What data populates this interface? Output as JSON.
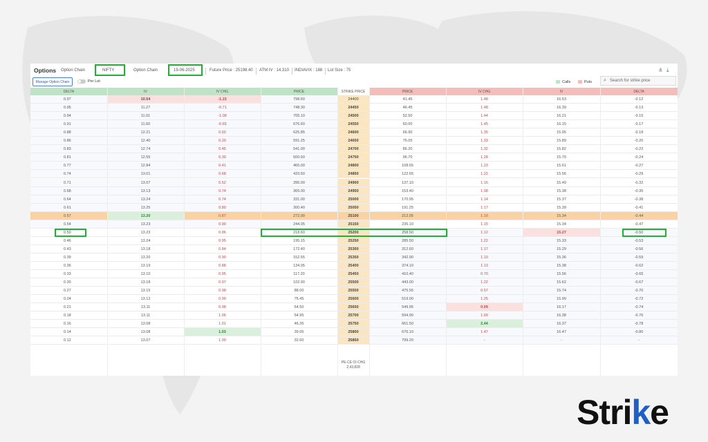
{
  "header": {
    "title": "Options",
    "tab_option_chain": "Option Chain",
    "symbol": "NIFTY",
    "tab_option_chain_2": "Option Chain",
    "expiry": "19-06-2025",
    "future_price": "Future Price : 25198.40",
    "atm_iv": "ATM IV : 14.310",
    "india_vix": "INDIAVIX : 188",
    "lot_size": "Lot Size : 75"
  },
  "toolbar": {
    "manage_label": "Manage Option Chain",
    "per_lot_label": "Per Lot",
    "legend_calls": "Calls",
    "legend_puts": "Puts",
    "search_placeholder": "Search for strike price"
  },
  "columns": {
    "call": [
      "DELTA",
      "IV",
      "IV CHG",
      "PRICE"
    ],
    "strike": "STRIKE PRICE",
    "put": [
      "PRICE",
      "IV CHG",
      "IV",
      "DELTA"
    ]
  },
  "rows": [
    {
      "strike": "24400",
      "c_delta": "0.97",
      "c_iv": "10.54",
      "c_ivchg": "-1.15",
      "c_price": "798.60",
      "p_price": "41.45",
      "p_ivchg": "1.48",
      "p_iv": "16.53",
      "p_delta": "-0.12"
    },
    {
      "strike": "24450",
      "c_delta": "0.95",
      "c_iv": "11.27",
      "c_ivchg": "-0.71",
      "c_price": "748.30",
      "p_price": "46.45",
      "p_ivchg": "1.48",
      "p_iv": "16.39",
      "p_delta": "-0.13"
    },
    {
      "strike": "24500",
      "c_delta": "0.94",
      "c_iv": "11.01",
      "c_ivchg": "-1.08",
      "c_price": "705.10",
      "p_price": "52.50",
      "p_ivchg": "1.44",
      "p_iv": "16.21",
      "p_delta": "-0.15"
    },
    {
      "strike": "24550",
      "c_delta": "0.91",
      "c_iv": "11.60",
      "c_ivchg": "-0.65",
      "c_price": "676.60",
      "p_price": "60.00",
      "p_ivchg": "1.45",
      "p_iv": "16.15",
      "p_delta": "-0.17"
    },
    {
      "strike": "24600",
      "c_delta": "0.88",
      "c_iv": "12.21",
      "c_ivchg": "0.02",
      "c_price": "625.85",
      "p_price": "66.90",
      "p_ivchg": "1.35",
      "p_iv": "15.95",
      "p_delta": "-0.18"
    },
    {
      "strike": "24650",
      "c_delta": "0.86",
      "c_iv": "12.40",
      "c_ivchg": "0.20",
      "c_price": "591.25",
      "p_price": "76.05",
      "p_ivchg": "1.33",
      "p_iv": "15.89",
      "p_delta": "-0.20"
    },
    {
      "strike": "24700",
      "c_delta": "0.83",
      "c_iv": "12.74",
      "c_ivchg": "0.45",
      "c_price": "541.00",
      "p_price": "86.20",
      "p_ivchg": "1.32",
      "p_iv": "15.82",
      "p_delta": "-0.22"
    },
    {
      "strike": "24750",
      "c_delta": "0.81",
      "c_iv": "12.55",
      "c_ivchg": "0.30",
      "c_price": "500.60",
      "p_price": "96.70",
      "p_ivchg": "1.28",
      "p_iv": "15.70",
      "p_delta": "-0.24"
    },
    {
      "strike": "24800",
      "c_delta": "0.77",
      "c_iv": "12.84",
      "c_ivchg": "0.41",
      "c_price": "465.00",
      "p_price": "108.65",
      "p_ivchg": "1.23",
      "p_iv": "15.61",
      "p_delta": "-0.27"
    },
    {
      "strike": "24850",
      "c_delta": "0.74",
      "c_iv": "13.01",
      "c_ivchg": "0.68",
      "c_price": "433.50",
      "p_price": "122.65",
      "p_ivchg": "1.22",
      "p_iv": "15.56",
      "p_delta": "-0.29"
    },
    {
      "strike": "24900",
      "c_delta": "0.71",
      "c_iv": "13.07",
      "c_ivchg": "0.52",
      "c_price": "395.00",
      "p_price": "137.10",
      "p_ivchg": "1.16",
      "p_iv": "15.49",
      "p_delta": "-0.32"
    },
    {
      "strike": "24950",
      "c_delta": "0.68",
      "c_iv": "13.13",
      "c_ivchg": "0.74",
      "c_price": "365.00",
      "p_price": "153.40",
      "p_ivchg": "1.08",
      "p_iv": "15.38",
      "p_delta": "-0.35"
    },
    {
      "strike": "25000",
      "c_delta": "0.64",
      "c_iv": "13.24",
      "c_ivchg": "0.74",
      "c_price": "331.00",
      "p_price": "170.95",
      "p_ivchg": "1.14",
      "p_iv": "15.37",
      "p_delta": "-0.38"
    },
    {
      "strike": "25050",
      "c_delta": "0.61",
      "c_iv": "13.25",
      "c_ivchg": "0.80",
      "c_price": "300.40",
      "p_price": "191.25",
      "p_ivchg": "1.17",
      "p_iv": "15.39",
      "p_delta": "-0.41"
    },
    {
      "strike": "25100",
      "c_delta": "0.57",
      "c_iv": "13.20",
      "c_ivchg": "0.87",
      "c_price": "272.00",
      "p_price": "212.05",
      "p_ivchg": "1.19",
      "p_iv": "15.34",
      "p_delta": "-0.44"
    },
    {
      "strike": "25150",
      "c_delta": "0.54",
      "c_iv": "13.23",
      "c_ivchg": "0.90",
      "c_price": "244.05",
      "p_price": "235.10",
      "p_ivchg": "1.15",
      "p_iv": "15.34",
      "p_delta": "-0.47"
    },
    {
      "strike": "25200",
      "c_delta": "0.50",
      "c_iv": "13.23",
      "c_ivchg": "0.86",
      "c_price": "218.60",
      "p_price": "258.50",
      "p_ivchg": "1.12",
      "p_iv": "15.27",
      "p_delta": "-0.50"
    },
    {
      "strike": "25250",
      "c_delta": "0.46",
      "c_iv": "13.24",
      "c_ivchg": "0.95",
      "c_price": "195.15",
      "p_price": "285.50",
      "p_ivchg": "1.22",
      "p_iv": "15.33",
      "p_delta": "-0.53"
    },
    {
      "strike": "25300",
      "c_delta": "0.43",
      "c_iv": "13.18",
      "c_ivchg": "0.84",
      "c_price": "172.40",
      "p_price": "312.60",
      "p_ivchg": "1.17",
      "p_iv": "15.29",
      "p_delta": "-0.56"
    },
    {
      "strike": "25350",
      "c_delta": "0.39",
      "c_iv": "13.20",
      "c_ivchg": "0.90",
      "c_price": "152.55",
      "p_price": "342.90",
      "p_ivchg": "1.10",
      "p_iv": "15.36",
      "p_delta": "-0.59"
    },
    {
      "strike": "25400",
      "c_delta": "0.36",
      "c_iv": "13.19",
      "c_ivchg": "0.88",
      "c_price": "134.05",
      "p_price": "374.10",
      "p_ivchg": "1.13",
      "p_iv": "15.38",
      "p_delta": "-0.62"
    },
    {
      "strike": "25450",
      "c_delta": "0.33",
      "c_iv": "13.10",
      "c_ivchg": "0.95",
      "c_price": "117.20",
      "p_price": "410.40",
      "p_ivchg": "0.70",
      "p_iv": "15.56",
      "p_delta": "-0.65"
    },
    {
      "strike": "25500",
      "c_delta": "0.30",
      "c_iv": "13.18",
      "c_ivchg": "0.97",
      "c_price": "102.00",
      "p_price": "443.00",
      "p_ivchg": "1.22",
      "p_iv": "15.62",
      "p_delta": "-0.67"
    },
    {
      "strike": "25550",
      "c_delta": "0.27",
      "c_iv": "13.15",
      "c_ivchg": "0.98",
      "c_price": "88.00",
      "p_price": "475.55",
      "p_ivchg": "0.57",
      "p_iv": "15.74",
      "p_delta": "-0.70"
    },
    {
      "strike": "25600",
      "c_delta": "0.24",
      "c_iv": "13.12",
      "c_ivchg": "0.99",
      "c_price": "75.45",
      "p_price": "519.00",
      "p_ivchg": "1.25",
      "p_iv": "15.99",
      "p_delta": "-0.72"
    },
    {
      "strike": "25650",
      "c_delta": "0.21",
      "c_iv": "13.11",
      "c_ivchg": "0.98",
      "c_price": "64.50",
      "p_price": "549.95",
      "p_ivchg": "0.09",
      "p_iv": "16.17",
      "p_delta": "-0.74"
    },
    {
      "strike": "25700",
      "c_delta": "0.18",
      "c_iv": "13.11",
      "c_ivchg": "1.06",
      "c_price": "54.95",
      "p_price": "594.90",
      "p_ivchg": "1.69",
      "p_iv": "16.38",
      "p_delta": "-0.76"
    },
    {
      "strike": "25750",
      "c_delta": "0.16",
      "c_iv": "13.08",
      "c_ivchg": "1.01",
      "c_price": "46.35",
      "p_price": "661.50",
      "p_ivchg": "2.44",
      "p_iv": "16.37",
      "p_delta": "-0.78"
    },
    {
      "strike": "25800",
      "c_delta": "0.14",
      "c_iv": "13.08",
      "c_ivchg": "1.03",
      "c_price": "39.05",
      "p_price": "676.10",
      "p_ivchg": "1.47",
      "p_iv": "16.47",
      "p_delta": "-0.80"
    },
    {
      "strike": "25850",
      "c_delta": "0.12",
      "c_iv": "13.07",
      "c_ivchg": "1.00",
      "c_price": "32.60",
      "p_price": "799.20",
      "p_ivchg": "-",
      "p_iv": "-",
      "p_delta": "-"
    }
  ],
  "footer": {
    "label": "PE-CE OI CHG",
    "value": "2,43,828"
  },
  "brand": {
    "logo_text_left": "Stri",
    "logo_text_k": "k",
    "logo_text_right": "e",
    "accent": "#1e5ec8"
  },
  "colors": {
    "call_header": "#bfe3c6",
    "put_header": "#f5bcbc",
    "strike_col": "#fbe6c4",
    "atm_row": "#fcd3a0",
    "highlight_box": "#1db233"
  }
}
